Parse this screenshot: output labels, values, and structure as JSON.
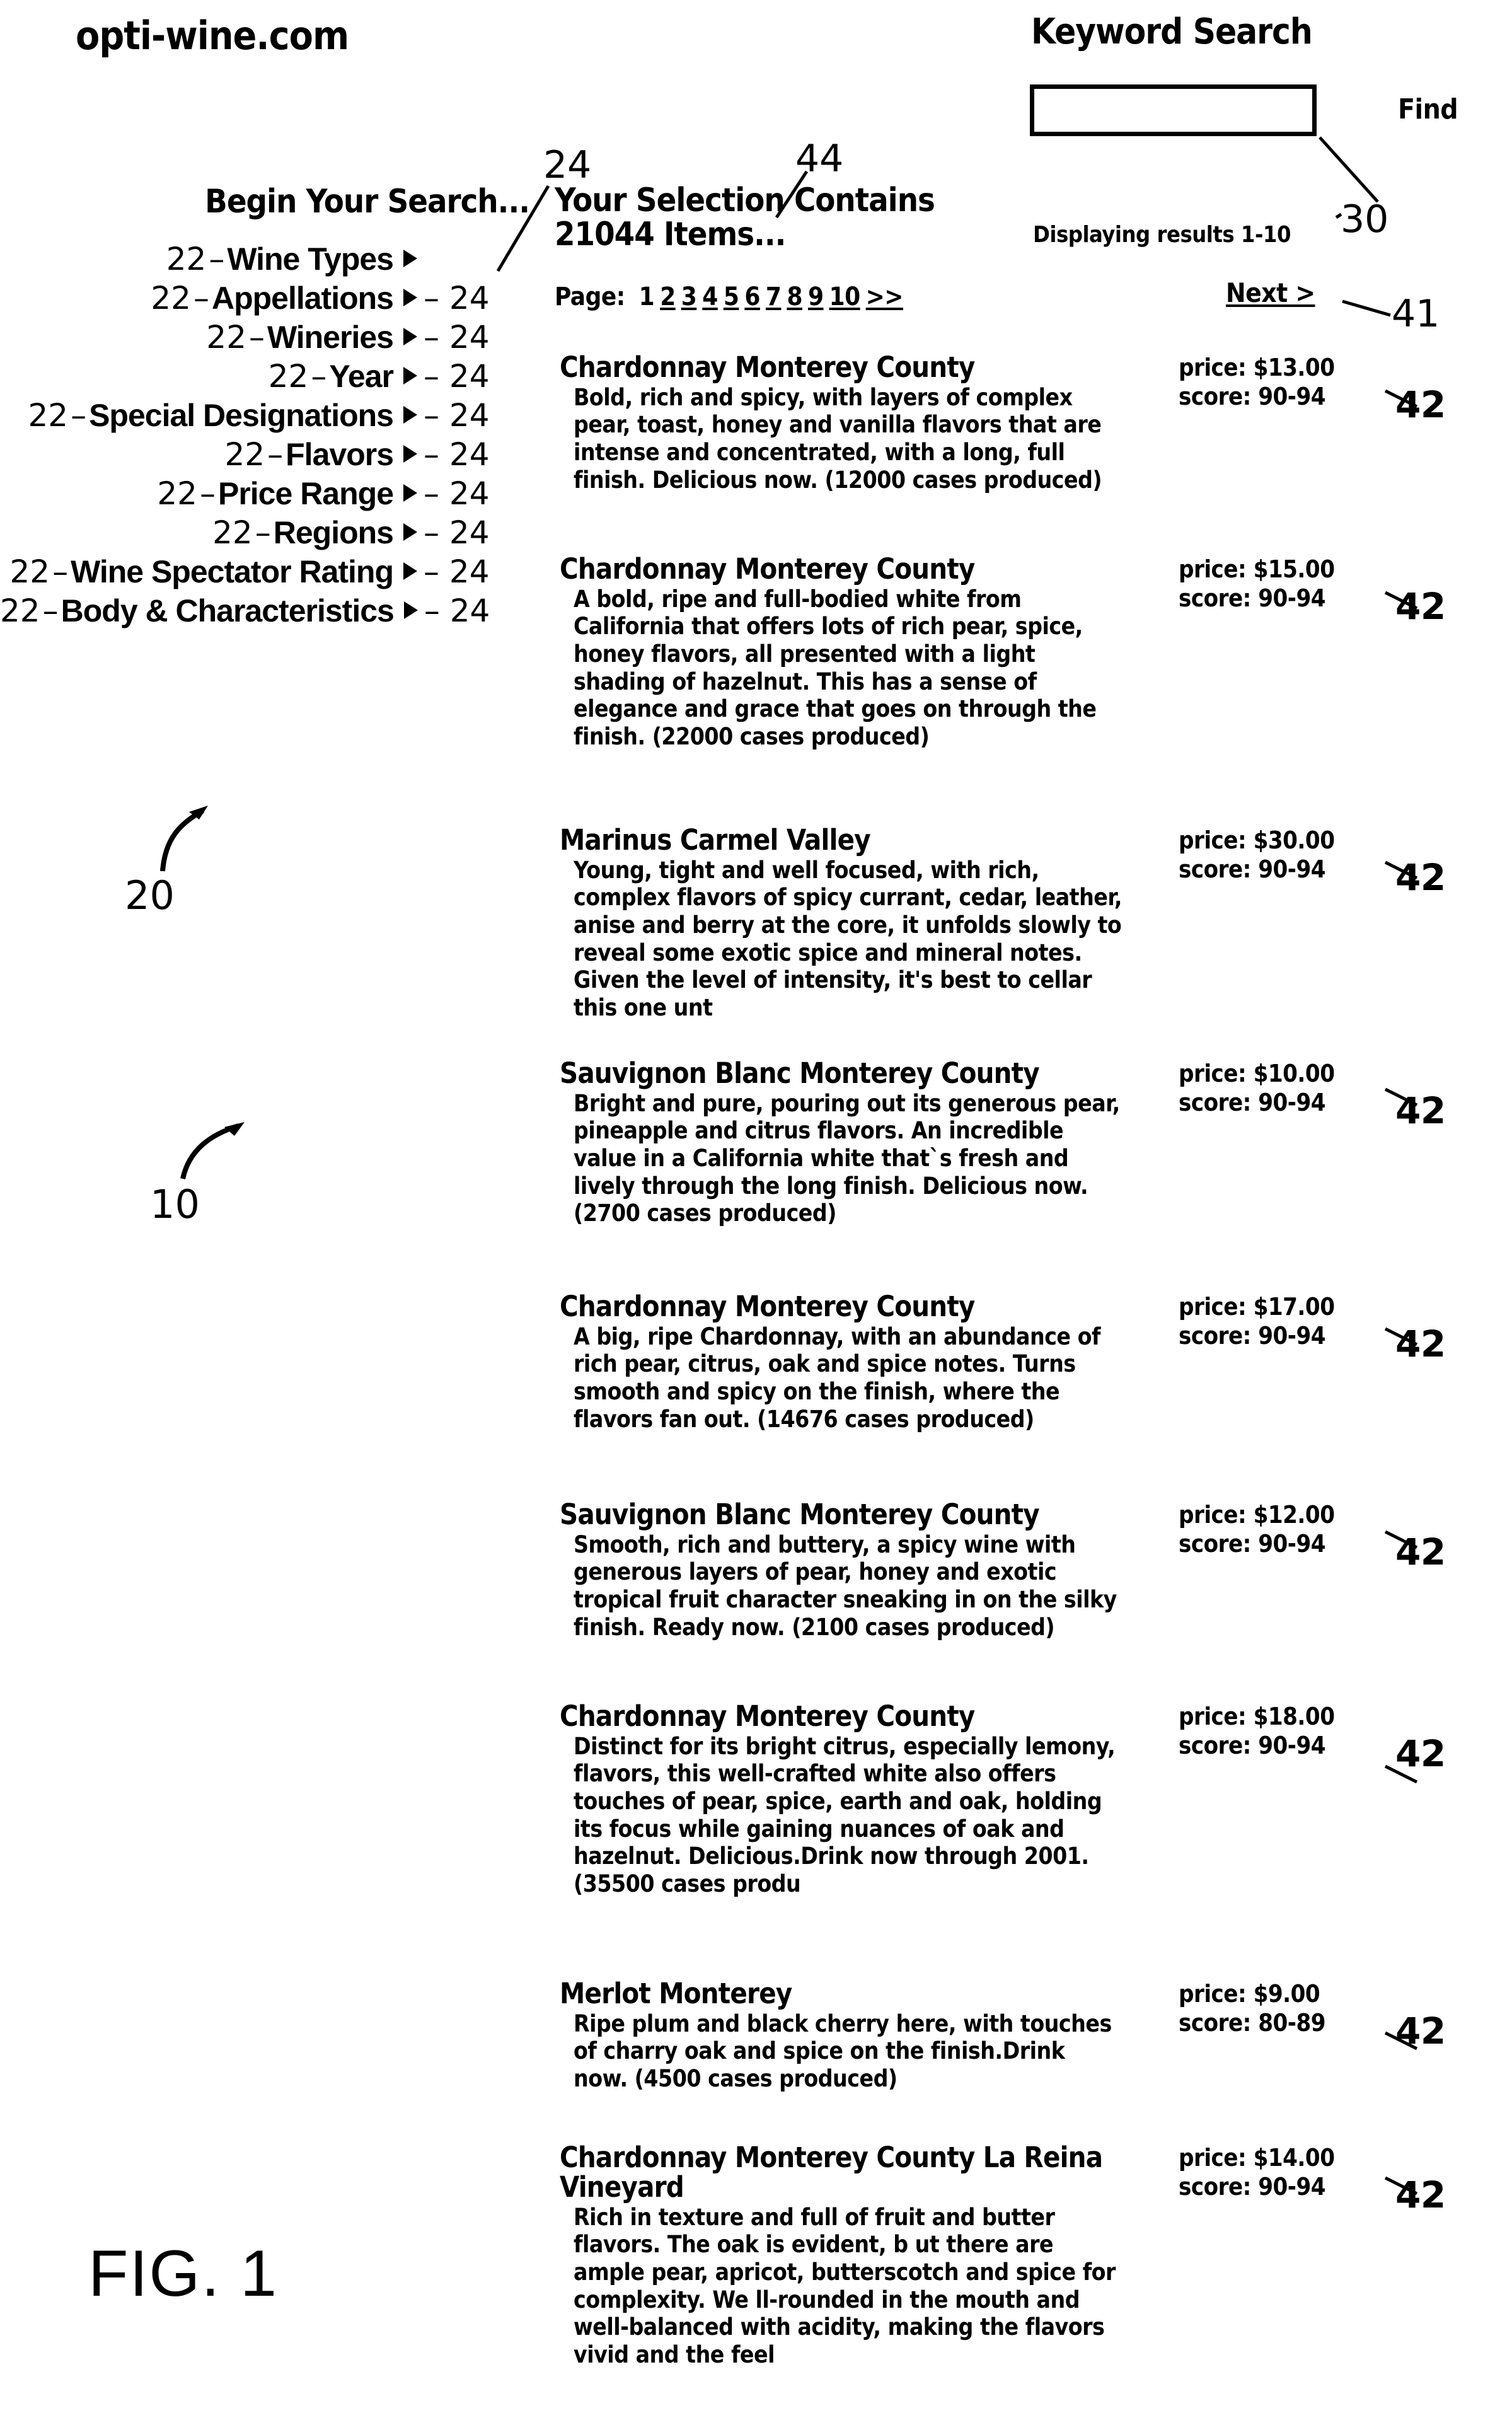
{
  "header": {
    "brand": "opti-wine.com",
    "keyword_search_label": "Keyword Search",
    "keyword_input_value": "",
    "keyword_input_placeholder": "",
    "find_label": "Find"
  },
  "search_panel": {
    "title": "Begin Your Search...",
    "callout": "20",
    "items": [
      {
        "num": "22",
        "label": "Wine Types",
        "lead": ""
      },
      {
        "num": "22",
        "label": "Appellations",
        "lead": "24"
      },
      {
        "num": "22",
        "label": "Wineries",
        "lead": "24"
      },
      {
        "num": "22",
        "label": "Year",
        "lead": "24"
      },
      {
        "num": "22",
        "label": "Special Designations",
        "lead": "24"
      },
      {
        "num": "22",
        "label": "Flavors",
        "lead": "24"
      },
      {
        "num": "22",
        "label": "Price Range",
        "lead": "24"
      },
      {
        "num": "22",
        "label": "Regions",
        "lead": "24"
      },
      {
        "num": "22",
        "label": "Wine Spectator Rating",
        "lead": "24"
      },
      {
        "num": "22",
        "label": "Body & Characteristics",
        "lead": "24"
      }
    ]
  },
  "results_panel": {
    "title_line1": "Your Selection Contains",
    "title_line2": "21044 Items...",
    "callout_title": "44",
    "callout_arrow": "24",
    "displaying_results": "Displaying results 1-10",
    "callout_search_box": "30",
    "pagination": {
      "label": "Page:",
      "pages": [
        "1",
        "2",
        "3",
        "4",
        "5",
        "6",
        "7",
        "8",
        "9",
        "10",
        ">>"
      ],
      "current": "1",
      "next_label": "Next >",
      "callout_next": "41"
    },
    "results": [
      {
        "name": "Chardonnay Monterey County",
        "description": "Bold, rich and spicy, with layers of complex pear, toast, honey and vanilla flavors that are intense and concentrated, with a long, full finish. Delicious now. (12000 cases produced)",
        "price": "price: $13.00",
        "score": "score: 90-94",
        "callout": "42"
      },
      {
        "name": "Chardonnay Monterey County",
        "description": "A bold, ripe and full-bodied white from California that offers lots of rich pear, spice, honey flavors, all presented with a light shading of hazelnut. This has a sense of elegance and grace that goes on through the finish. (22000 cases produced)",
        "price": "price: $15.00",
        "score": "score: 90-94",
        "callout": "42"
      },
      {
        "name": "Marinus Carmel Valley",
        "description": "Young, tight and well focused, with rich, complex flavors of spicy currant, cedar, leather, anise and berry at the core, it unfolds slowly to reveal some exotic spice and mineral notes. Given the level of intensity, it's best to cellar this one unt",
        "price": "price: $30.00",
        "score": "score: 90-94",
        "callout": "42"
      },
      {
        "name": "Sauvignon Blanc Monterey County",
        "description": "Bright and pure, pouring out its generous pear, pineapple and citrus flavors. An incredible value in a California white that`s fresh and lively through the long finish. Delicious now. (2700 cases produced)",
        "price": "price: $10.00",
        "score": "score: 90-94",
        "callout": "42"
      },
      {
        "name": "Chardonnay Monterey County",
        "description": "A big, ripe Chardonnay, with an abundance of rich pear, citrus, oak and spice notes. Turns smooth and spicy on the finish, where the flavors fan out. (14676 cases produced)",
        "price": "price: $17.00",
        "score": "score: 90-94",
        "callout": "42"
      },
      {
        "name": "Sauvignon Blanc Monterey County",
        "description": "Smooth, rich and buttery, a spicy wine with generous layers of pear, honey and exotic tropical fruit character sneaking in on the silky finish. Ready now. (2100 cases produced)",
        "price": "price: $12.00",
        "score": "score: 90-94",
        "callout": "42"
      },
      {
        "name": "Chardonnay Monterey County",
        "description": "Distinct for its bright citrus, especially lemony, flavors, this well-crafted white also offers touches of pear, spice, earth and oak, holding its focus while gaining nuances of oak and hazelnut. Delicious.Drink now through 2001. (35500 cases produ",
        "price": "price: $18.00",
        "score": "score: 90-94",
        "callout": "42"
      },
      {
        "name": "Merlot Monterey",
        "description": "Ripe plum and black cherry here, with touches of charry oak and spice on the finish.Drink now. (4500 cases produced)",
        "price": "price: $9.00",
        "score": "score: 80-89",
        "callout": "42"
      },
      {
        "name": "Chardonnay Monterey County La Reina Vineyard",
        "description": "Rich in texture and full of fruit and butter flavors. The oak is evident, b ut there are ample pear, apricot, butterscotch and spice for complexity. We ll-rounded in the mouth and well-balanced with acidity, making the flavors vivid and the feel",
        "price": "price: $14.00",
        "score": "score: 90-94",
        "callout": "42"
      }
    ]
  },
  "figure": {
    "caption": "FIG. 1",
    "callout_system": "10",
    "callout_panel": "20"
  }
}
